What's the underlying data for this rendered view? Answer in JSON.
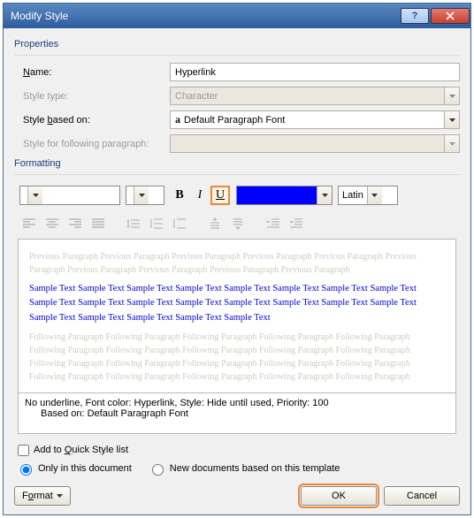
{
  "title": "Modify Style",
  "properties": {
    "group_label": "Properties",
    "name_label": "Name:",
    "name_value": "Hyperlink",
    "type_label": "Style type:",
    "type_value": "Character",
    "based_label": "Style based on:",
    "based_value": "Default Paragraph Font",
    "following_label": "Style for following paragraph:",
    "following_value": ""
  },
  "formatting": {
    "group_label": "Formatting",
    "font_name": "",
    "font_size": "",
    "bold": "B",
    "italic": "I",
    "underline": "U",
    "color_hex": "#0000ff",
    "script": "Latin"
  },
  "preview": {
    "prev_para": "Previous Paragraph Previous Paragraph Previous Paragraph Previous Paragraph Previous Paragraph Previous Paragraph Previous Paragraph Previous Paragraph Previous Paragraph Previous Paragraph",
    "sample1": "Sample Text Sample Text Sample Text Sample Text Sample Text Sample Text Sample Text Sample Text",
    "sample2": "Sample Text Sample Text Sample Text Sample Text Sample Text Sample Text Sample Text Sample Text",
    "sample3": "Sample Text Sample Text Sample Text Sample Text Sample Text",
    "follow_para": "Following Paragraph Following Paragraph Following Paragraph Following Paragraph Following Paragraph Following Paragraph Following Paragraph Following Paragraph Following Paragraph Following Paragraph Following Paragraph Following Paragraph Following Paragraph Following Paragraph Following Paragraph Following Paragraph Following Paragraph Following Paragraph Following Paragraph Following Paragraph"
  },
  "description": {
    "line1": "No underline, Font color: Hyperlink, Style: Hide until used, Priority: 100",
    "line2": "Based on: Default Paragraph Font"
  },
  "options": {
    "quick_style": "Add to Quick Style list",
    "only_doc": "Only in this document",
    "new_docs": "New documents based on this template"
  },
  "buttons": {
    "format": "Format",
    "ok": "OK",
    "cancel": "Cancel"
  }
}
